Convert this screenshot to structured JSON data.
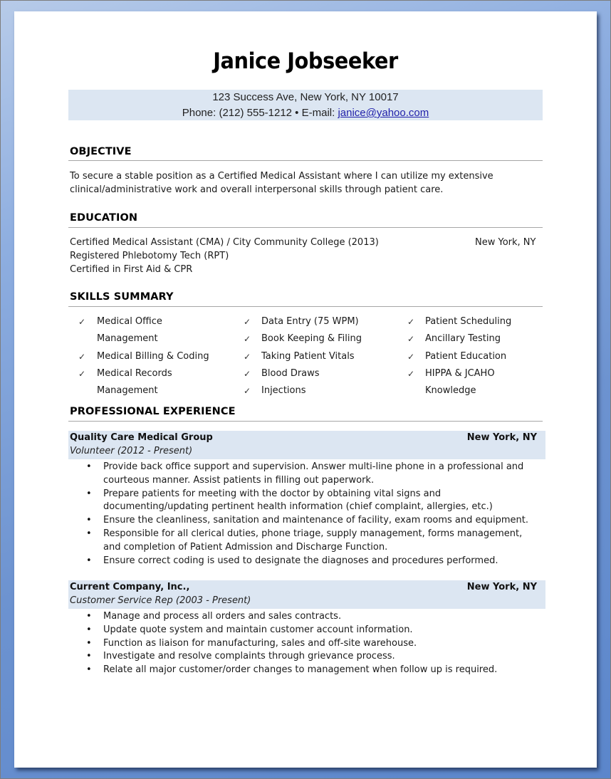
{
  "resume": {
    "name": "Janice Jobseeker",
    "contact": {
      "address": "123 Success Ave, New York, NY 10017",
      "phone_label": "Phone: (212) 555-1212 • E-mail: ",
      "email": "janice@yahoo.com"
    },
    "objective": {
      "title": "OBJECTIVE",
      "lines": [
        "To secure a stable position  as a Certified Medical Assistant  where I can utilize  my extensive",
        "clinical/administrative  work and overall interpersonal skills through  patient care."
      ]
    },
    "education": {
      "title": "EDUCATION",
      "lines": [
        "Certified Medical  Assistant  (CMA) / City  Community  College  (2013)",
        "Registered Phlebotomy Tech (RPT)",
        "Certified in First Aid & CPR"
      ],
      "location": "New York, NY"
    },
    "skills": {
      "title": "SKILLS SUMMARY",
      "check_glyph": "✓",
      "columns": [
        [
          {
            "line1": "Medical Office",
            "line2": "Management"
          },
          {
            "line1": "Medical Billing  & Coding"
          },
          {
            "line1": "Medical Records",
            "line2": "Management"
          }
        ],
        [
          {
            "line1": "Data Entry  (75 WPM)"
          },
          {
            "line1": "Book Keeping  & Filing"
          },
          {
            "line1": "Taking Patient  Vitals"
          },
          {
            "line1": "Blood Draws"
          },
          {
            "line1": "Injections"
          }
        ],
        [
          {
            "line1": "Patient Scheduling"
          },
          {
            "line1": "Ancillary Testing"
          },
          {
            "line1": "Patient Education"
          },
          {
            "line1": "HIPPA & JCAHO",
            "line2": "Knowledge"
          }
        ]
      ]
    },
    "experience": {
      "title": "PROFESSIONAL EXPERIENCE",
      "bullet_glyph": "•",
      "jobs": [
        {
          "company": "Quality Care Medical Group",
          "location": "New York, NY",
          "role": "Volunteer (2012  - Present)",
          "bullets": [
            [
              "Provide back office support  and supervision.   Answer multi-line  phone in a professional and",
              "courteous manner.  Assist patients  in filling out paperwork."
            ],
            [
              "Prepare patients  for meeting with the doctor by obtaining vital signs and",
              "documenting/updating  pertinent  health information (chief complaint, allergies, etc.)"
            ],
            [
              "Ensure the cleanliness,  sanitation  and maintenance  of facility, exam rooms and equipment."
            ],
            [
              "Responsible  for all clerical duties, phone triage, supply management,  forms management,",
              "and completion  of Patient Admission  and Discharge Function."
            ],
            [
              "Ensure correct coding is used to designate the diagnoses and procedures performed."
            ]
          ]
        },
        {
          "company": "Current Company, Inc.,",
          "location": "New York, NY",
          "role": "Customer Service Rep (2003  - Present)",
          "bullets": [
            [
              "Manage and process all orders and sales contracts."
            ],
            [
              "Update quote system and maintain  customer account information."
            ],
            [
              "Function as liaison  for manufacturing,  sales and off-site warehouse."
            ],
            [
              "Investigate  and resolve complaints  through  grievance process."
            ],
            [
              "Relate all major customer/order changes to management  when  follow up is required."
            ]
          ]
        }
      ]
    },
    "colors": {
      "band_fill": "#dce6f2",
      "rule": "#a6a6a6",
      "link": "#1f1faa",
      "window_bg": "#6d93d0"
    }
  }
}
